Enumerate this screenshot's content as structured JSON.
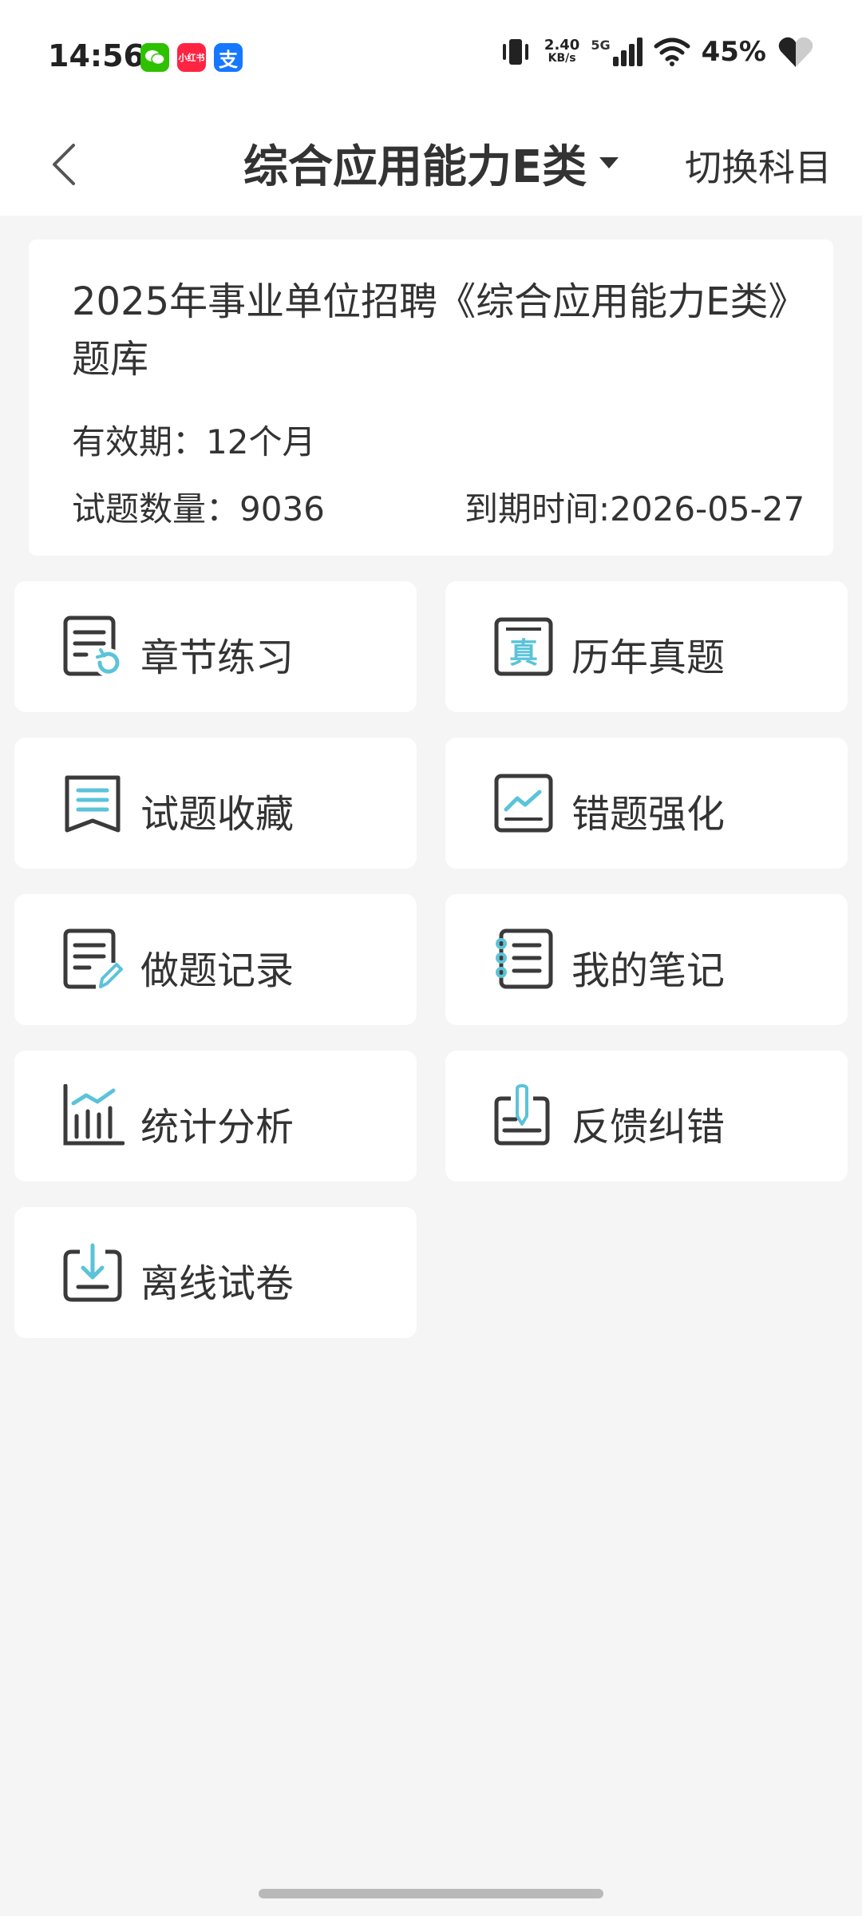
{
  "status_bar": {
    "time": "14:56",
    "apps": [
      "wechat-icon",
      "xiaohongshu-icon",
      "alipay-icon"
    ],
    "xiaohongshu_text": "小红书",
    "alipay_text": "支",
    "net_speed_value": "2.40",
    "net_speed_unit": "KB/s",
    "network": "5G",
    "battery": "45%"
  },
  "header": {
    "title": "综合应用能力E类",
    "switch_label": "切换科目"
  },
  "info": {
    "title": "2025年事业单位招聘《综合应用能力E类》题库",
    "validity": "有效期：12个月",
    "question_count": "试题数量：9036",
    "expiry": "到期时间:2026-05-27"
  },
  "menu": {
    "chapter": "章节练习",
    "past_papers": "历年真题",
    "favorites": "试题收藏",
    "wrong_questions": "错题强化",
    "records": "做题记录",
    "notes": "我的笔记",
    "statistics": "统计分析",
    "feedback": "反馈纠错",
    "offline": "离线试卷"
  },
  "colors": {
    "accent": "#5bc3d9",
    "icon_dark": "#3a3a3a",
    "text": "#333333",
    "background": "#f5f5f5"
  }
}
